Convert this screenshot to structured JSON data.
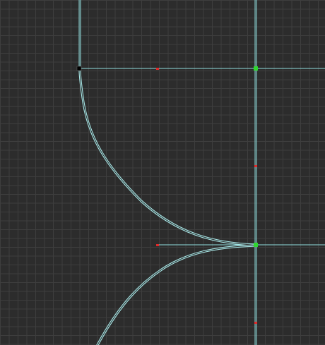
{
  "viewport": {
    "background_color": "#2c2c2c",
    "grid_color": "#3e3e3e",
    "guide_color": "#8fdede",
    "curve_color": "#a8e8e8",
    "handle_color": "#e02a2a",
    "selected_anchor_color": "#2ed82e",
    "unselected_anchor_color": "#000000"
  }
}
